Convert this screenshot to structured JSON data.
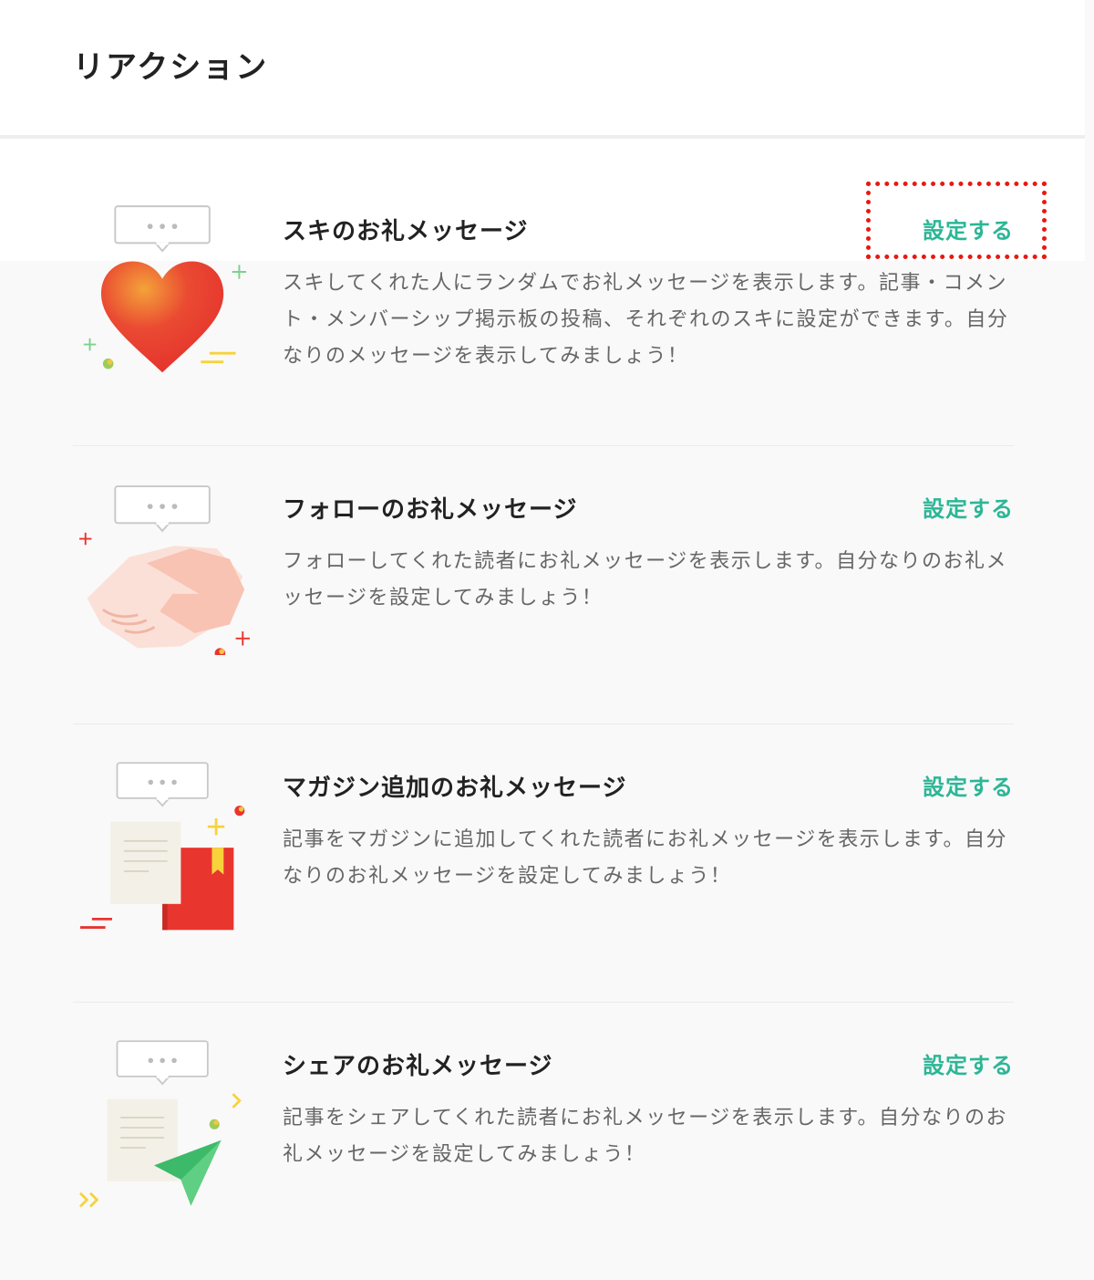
{
  "page": {
    "title": "リアクション"
  },
  "items": [
    {
      "title": "スキのお礼メッセージ",
      "description": "スキしてくれた人にランダムでお礼メッセージを表示します。記事・コメント・メンバーシップ掲示板の投稿、それぞれのスキに設定ができます。自分なりのメッセージを表示してみましょう！",
      "action_label": "設定する",
      "illustration": "heart-icon"
    },
    {
      "title": "フォローのお礼メッセージ",
      "description": "フォローしてくれた読者にお礼メッセージを表示します。自分なりのお礼メッセージを設定してみましょう！",
      "action_label": "設定する",
      "illustration": "handshake-icon"
    },
    {
      "title": "マガジン追加のお礼メッセージ",
      "description": "記事をマガジンに追加してくれた読者にお礼メッセージを表示します。自分なりのお礼メッセージを設定してみましょう！",
      "action_label": "設定する",
      "illustration": "magazine-book-icon"
    },
    {
      "title": "シェアのお礼メッセージ",
      "description": "記事をシェアしてくれた読者にお礼メッセージを表示します。自分なりのお礼メッセージを設定してみましょう！",
      "action_label": "設定する",
      "illustration": "paper-plane-icon"
    }
  ],
  "colors": {
    "accent": "#2cb696",
    "highlight": "#e8190f",
    "heart": "#e8352e"
  }
}
